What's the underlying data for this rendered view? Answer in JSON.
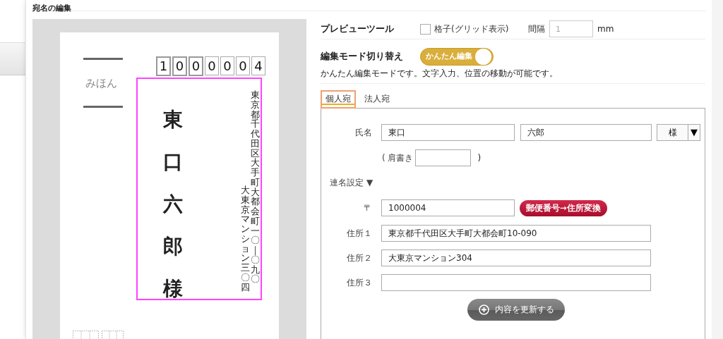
{
  "dialog": {
    "title": "宛名の編集"
  },
  "preview": {
    "sample_label": "みほん",
    "postal_code_digits": [
      "1",
      "0",
      "0",
      "0",
      "0",
      "0",
      "4"
    ],
    "name_column": "東口六郎様",
    "address_columns": [
      "東京都千代田区大手町大都会町一〇｜〇九〇",
      "大東京マンション三〇四"
    ]
  },
  "preview_tools": {
    "label": "プレビューツール",
    "grid_checkbox": {
      "label": "格子(グリッド表示)",
      "checked": false
    },
    "interval": {
      "label": "間隔",
      "placeholder": "1",
      "unit": "mm"
    }
  },
  "edit_mode": {
    "label": "編集モード切り替え",
    "toggle": {
      "label": "かんたん編集",
      "on": true
    },
    "description": "かんたん編集モードです。文字入力、位置の移動が可能です。"
  },
  "tabs": [
    {
      "label": "個人宛",
      "selected": true
    },
    {
      "label": "法人宛",
      "selected": false
    }
  ],
  "form": {
    "name": {
      "label": "氏名",
      "family": "東口",
      "given": "六郎",
      "honorific": "様",
      "caret": "▼"
    },
    "title": {
      "prefix": "( 肩書き",
      "suffix": ")"
    },
    "joint_names": {
      "label": "連名設定",
      "caret": "▼"
    },
    "postal": {
      "label": "〒",
      "value": "1000004",
      "button": "郵便番号→住所変換"
    },
    "addresses": [
      {
        "label": "住所１",
        "value": "東京都千代田区大手町大都会町10-090"
      },
      {
        "label": "住所２",
        "value": "大東京マンション304"
      },
      {
        "label": "住所３"
      }
    ],
    "update_button": "内容を更新する"
  }
}
